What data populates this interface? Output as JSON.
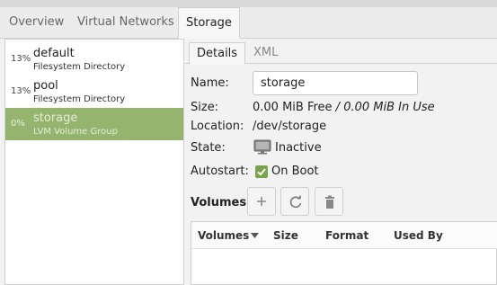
{
  "top_tabs": [
    "Overview",
    "Virtual Networks",
    "Storage"
  ],
  "pools": [
    {
      "pct": "13%",
      "name": "default",
      "type": "Filesystem Directory"
    },
    {
      "pct": "13%",
      "name": "pool",
      "type": "Filesystem Directory"
    },
    {
      "pct": "0%",
      "name": "storage",
      "type": "LVM Volume Group"
    }
  ],
  "detail_tabs": [
    "Details",
    "XML"
  ],
  "details": {
    "name_label": "Name:",
    "name_value": "storage",
    "size_label": "Size:",
    "size_free": "0.00 MiB Free",
    "size_sep": " / ",
    "size_in_use": "0.00 MiB In Use",
    "location_label": "Location:",
    "location_value": "/dev/storage",
    "state_label": "State:",
    "state_value": "Inactive",
    "autostart_label": "Autostart:",
    "autostart_value": "On Boot"
  },
  "volumes": {
    "title": "Volumes",
    "columns": [
      "Volumes",
      "Size",
      "Format",
      "Used By"
    ]
  },
  "colors": {
    "selection": "#95b56e",
    "check": "#7aa34d"
  }
}
